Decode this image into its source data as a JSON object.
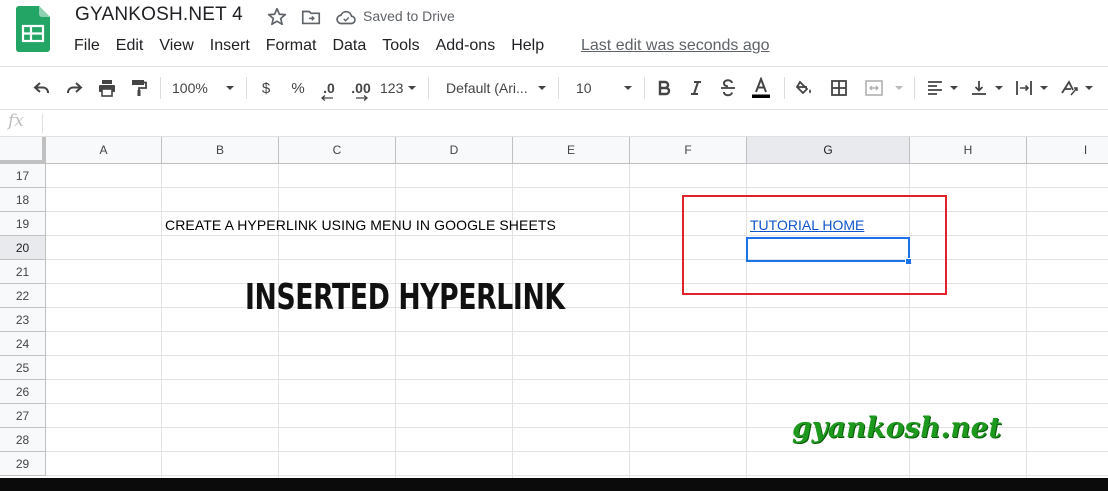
{
  "app": {
    "doc_title": "GYANKOSH.NET 4",
    "saved_status": "Saved to Drive",
    "last_edit": "Last edit was seconds ago"
  },
  "menu": [
    "File",
    "Edit",
    "View",
    "Insert",
    "Format",
    "Data",
    "Tools",
    "Add-ons",
    "Help"
  ],
  "toolbar": {
    "zoom": "100%",
    "currency": "$",
    "percent": "%",
    "decrease_decimal": ".0",
    "increase_decimal": ".00",
    "more_formats": "123",
    "font": "Default (Ari...",
    "font_size": "10"
  },
  "formula_bar": {
    "fx_label": "fx"
  },
  "columns": [
    "A",
    "B",
    "C",
    "D",
    "E",
    "F",
    "G",
    "H",
    "I"
  ],
  "rows": [
    "17",
    "18",
    "19",
    "20",
    "21",
    "22",
    "23",
    "24",
    "25",
    "26",
    "27",
    "28",
    "29"
  ],
  "selected": {
    "column": "G",
    "row": "20"
  },
  "cells": {
    "B19": "CREATE A HYPERLINK USING MENU IN GOOGLE SHEETS",
    "G19": "TUTORIAL HOME"
  },
  "annotation": "INSERTED HYPERLINK",
  "watermark": "gyankosh.net",
  "colors": {
    "link": "#1155cc",
    "selection": "#1a73e8",
    "highlight_box": "#e0222a",
    "watermark": "#1d9a1d"
  }
}
